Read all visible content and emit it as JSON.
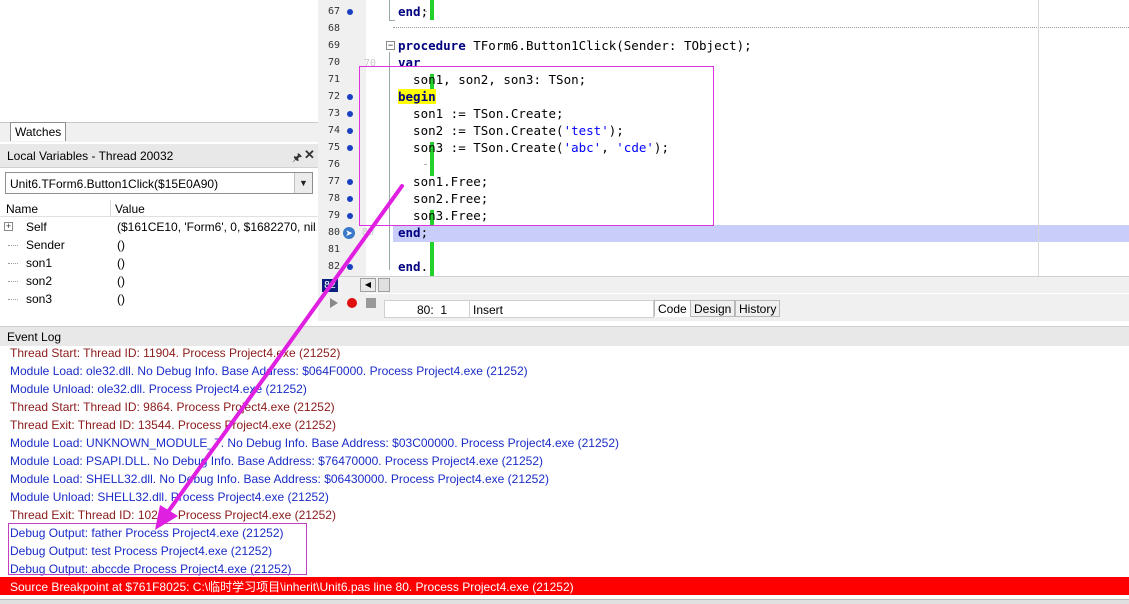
{
  "left_panel": {
    "watches_tab": "Watches",
    "locals_title": "Local Variables - Thread 20032",
    "frame_select_value": "Unit6.TForm6.Button1Click($15E0A90)",
    "columns": {
      "name": "Name",
      "value": "Value"
    },
    "variables": [
      {
        "name": "Self",
        "value": "($161CE10, 'Form6', 0, $1682270, nil,..."
      },
      {
        "name": "Sender",
        "value": "()"
      },
      {
        "name": "son1",
        "value": "()"
      },
      {
        "name": "son2",
        "value": "()"
      },
      {
        "name": "son3",
        "value": "()"
      }
    ]
  },
  "editor": {
    "line_numbers": [
      "67",
      "68",
      "69",
      "70",
      "71",
      "72",
      "73",
      "74",
      "75",
      "76",
      "77",
      "78",
      "79",
      "80",
      "81",
      "82"
    ],
    "current_line_badge": "82",
    "ghost_line_70": "70",
    "ghost_line_80": "80",
    "code": {
      "l67_kw": "end",
      "l67_rest": ";",
      "l69_kw": "procedure",
      "l69_rest": " TForm6.Button1Click(Sender: TObject);",
      "l70_kw": "var",
      "l71": "  son1, son2, son3: TSon;",
      "l72_kw": "begin",
      "l73": "  son1 := TSon.Create;",
      "l74_a": "  son2 := TSon.Create(",
      "l74_s": "'test'",
      "l74_b": ");",
      "l75_a": "  son3 := TSon.Create(",
      "l75_s1": "'abc'",
      "l75_m": ", ",
      "l75_s2": "'cde'",
      "l75_b": ");",
      "l77": "  son1.Free;",
      "l78": "  son2.Free;",
      "l79": "  son3.Free;",
      "l80_kw": "end",
      "l80_rest": ";",
      "l82_kw": "end",
      "l82_rest": "."
    }
  },
  "status": {
    "cursor_pos": "80:  1",
    "mode": "Insert",
    "tabs": [
      "Code",
      "Design",
      "History"
    ]
  },
  "event_log": {
    "title": "Event Log",
    "lines": [
      {
        "kind": "thread",
        "text": "Thread Start: Thread ID: 11904. Process Project4.exe (21252)"
      },
      {
        "kind": "module",
        "text": "Module Load: ole32.dll. No Debug Info. Base Address: $064F0000. Process Project4.exe (21252)"
      },
      {
        "kind": "module",
        "text": "Module Unload: ole32.dll. Process Project4.exe (21252)"
      },
      {
        "kind": "thread",
        "text": "Thread Start: Thread ID: 9864. Process Project4.exe (21252)"
      },
      {
        "kind": "thread",
        "text": "Thread Exit: Thread ID: 13544. Process Project4.exe (21252)"
      },
      {
        "kind": "module",
        "text": "Module Load: UNKNOWN_MODULE_7. No Debug Info. Base Address: $03C00000. Process Project4.exe (21252)"
      },
      {
        "kind": "module",
        "text": "Module Load: PSAPI.DLL. No Debug Info. Base Address: $76470000. Process Project4.exe (21252)"
      },
      {
        "kind": "module",
        "text": "Module Load: SHELL32.dll. No Debug Info. Base Address: $06430000. Process Project4.exe (21252)"
      },
      {
        "kind": "module",
        "text": "Module Unload: SHELL32.dll. Process Project4.exe (21252)"
      },
      {
        "kind": "thread",
        "text": "Thread Exit: Thread ID: 10292. Process Project4.exe (21252)"
      },
      {
        "kind": "debug",
        "text": "Debug Output: father Process Project4.exe (21252)"
      },
      {
        "kind": "debug",
        "text": "Debug Output: test Process Project4.exe (21252)"
      },
      {
        "kind": "debug",
        "text": "Debug Output: abccde Process Project4.exe (21252)"
      }
    ],
    "breakpoint": "Source Breakpoint at $761F8025: C:\\临时学习项目\\inherit\\Unit6.pas line 80. Process Project4.exe (21252)"
  },
  "colors": {
    "breakpoint_bar": "#ff0000",
    "exec_line": "#c8cdfa",
    "change_bar": "#22d22a",
    "annotation": "#e030e0",
    "keyword": "#000080",
    "string": "#0000ff"
  }
}
